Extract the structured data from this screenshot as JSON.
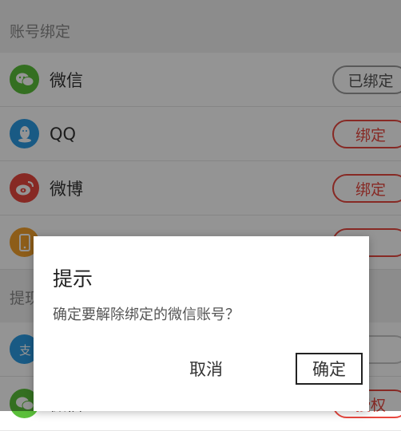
{
  "sections": {
    "account_binding": "账号绑定",
    "withdraw": "提现"
  },
  "rows": {
    "wechat": {
      "label": "微信",
      "action": "已绑定",
      "icon": "wechat-icon",
      "color": "#5bbf3a"
    },
    "qq": {
      "label": "QQ",
      "action": "绑定",
      "icon": "qq-icon",
      "color": "#2c9ce4"
    },
    "weibo": {
      "label": "微博",
      "action": "绑定",
      "icon": "weibo-icon",
      "color": "#e8473e"
    },
    "phone": {
      "label": "",
      "action": "",
      "icon": "phone-icon",
      "color": "#f3a12c"
    },
    "alipay": {
      "label": "",
      "action": "",
      "icon": "alipay-icon",
      "color": "#2c9ce4"
    },
    "wechat_withdraw": {
      "label": "微信",
      "action": "授权",
      "icon": "wechat-icon",
      "color": "#5bbf3a"
    }
  },
  "dialog": {
    "title": "提示",
    "message": "确定要解除绑定的微信账号？",
    "cancel": "取消",
    "confirm": "确定"
  },
  "colors": {
    "accent": "#e8473e",
    "bound_border": "#9a9a9a"
  }
}
